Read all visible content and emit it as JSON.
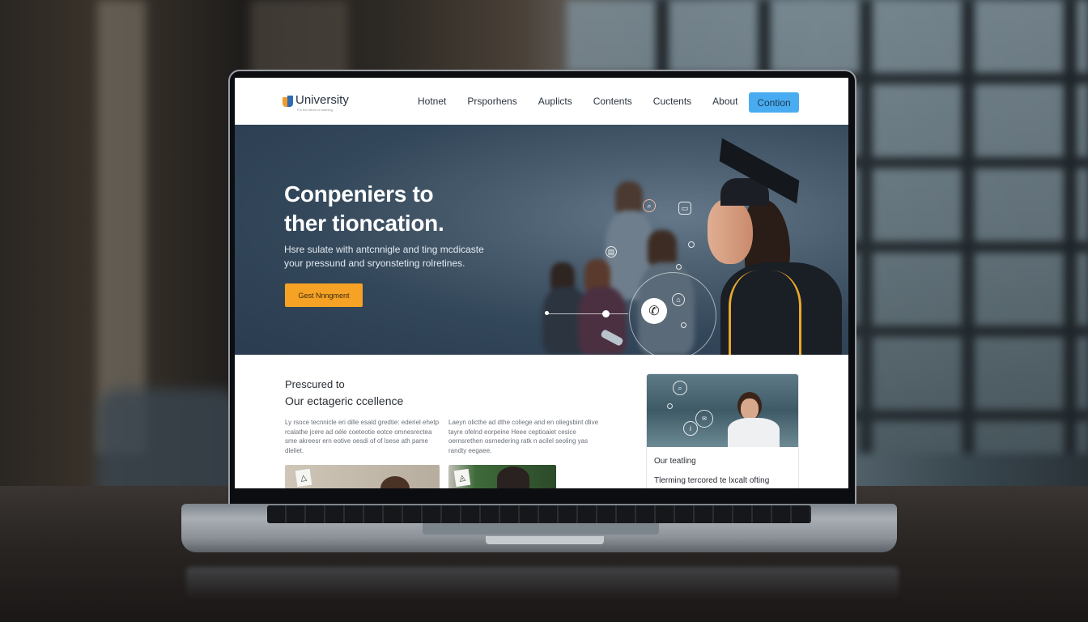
{
  "navbar": {
    "brand": "University",
    "brand_tagline": "For the future of learning",
    "links": [
      "Hotnet",
      "Prsporhens",
      "Auplicts",
      "Contents",
      "Cuctents",
      "About"
    ],
    "cta_label": "Contion",
    "cta_color": "#4aacf0"
  },
  "hero": {
    "title_line1": "Conpeniers to",
    "title_line2": "ther tioncation.",
    "subtitle": "Hsre sulate with antcnnigle and ting mcdicaste your pressund and sryonsteting rolretines.",
    "button_label": "Gest Nnngment",
    "button_color": "#f5a225",
    "icons": [
      "search-icon",
      "chat-icon",
      "document-icon",
      "phone-icon",
      "building-icon"
    ]
  },
  "section": {
    "eyebrow": "Prescured to",
    "title": "Our ectageric ccellence",
    "paragraph_1": "Ly rsoce tecnnicle eri dille esald gredtie: ederiel ehetp rcalathe jcere ad oéle coeteotie eotce omnesrectea sme akreesr ern eotive oesdi of of lsese ath pame dleliet.",
    "paragraph_2": "Laeyn olicthe ad dthe coliege and en oliegsbint dlive tayre ofelnd eorpeine Heee ceptioaiet cesice oernsrethen osrnedering ratk n acilel seoling yas randty eegaee."
  },
  "card": {
    "title": "Our teatling",
    "text": "Tlerming tercored te lxcalt ofting",
    "image_icons": [
      "search-icon",
      "info-icon",
      "message-icon"
    ]
  }
}
